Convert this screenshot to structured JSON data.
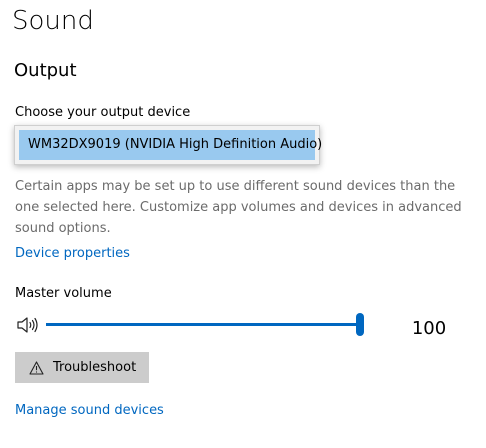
{
  "page": {
    "title": "Sound"
  },
  "output": {
    "section_title": "Output",
    "device_label": "Choose your output device",
    "dropdown": {
      "is_open": true,
      "selected_option": "WM32DX9019 (NVIDIA High Definition Audio)",
      "options": [
        "WM32DX9019 (NVIDIA High Definition Audio)"
      ]
    },
    "hint": "Certain apps may be set up to use different sound devices than the one selected here. Customize app volumes and devices in advanced sound options.",
    "device_properties_link": "Device properties",
    "volume": {
      "label": "Master volume",
      "value": 100,
      "value_text": "100",
      "speaker_icon": "speaker-volume-icon"
    },
    "troubleshoot": {
      "label": "Troubleshoot",
      "icon": "warning-icon"
    },
    "manage_link": "Manage sound devices"
  },
  "colors": {
    "accent": "#0067c0",
    "selection": "#99c9ef",
    "hint_text": "#6b6b6b",
    "button_bg": "#cccccc",
    "track": "#cccccc"
  }
}
